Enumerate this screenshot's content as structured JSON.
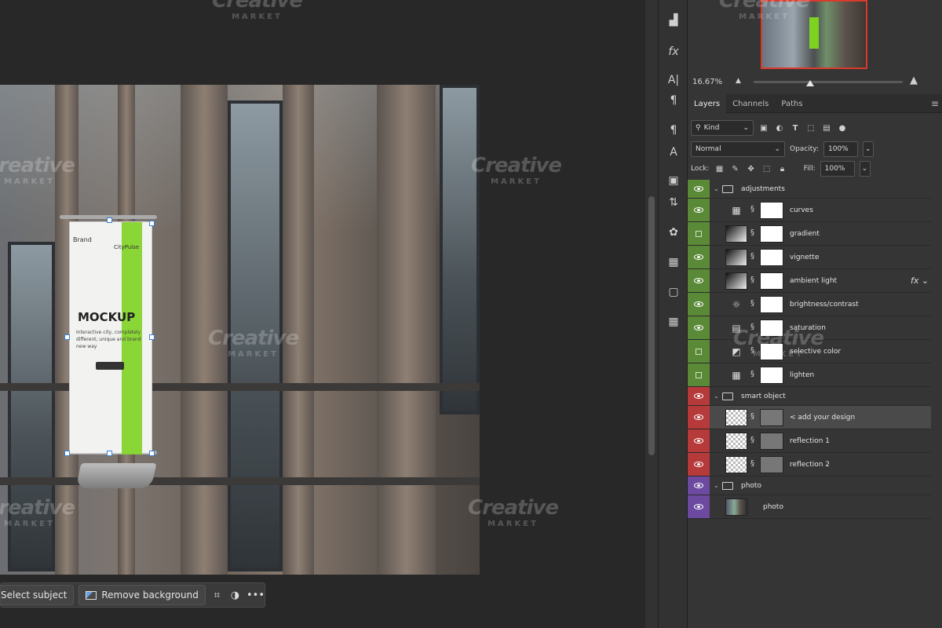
{
  "zoom": {
    "value": "16.67%"
  },
  "panel_tabs": [
    {
      "label": "Layers",
      "active": true
    },
    {
      "label": "Channels",
      "active": false
    },
    {
      "label": "Paths",
      "active": false
    }
  ],
  "filter": {
    "kind_label": "Kind"
  },
  "blend": {
    "mode": "Normal",
    "opacity_label": "Opacity:",
    "opacity_value": "100%"
  },
  "lock": {
    "label": "Lock:",
    "fill_label": "Fill:",
    "fill_value": "100%"
  },
  "layers": [
    {
      "name": "adjustments",
      "type": "group",
      "color": "#5a8a37"
    },
    {
      "name": "curves",
      "type": "adjustment",
      "icon": "curves-icon",
      "color": "#5a8a37",
      "visible": true
    },
    {
      "name": "gradient",
      "type": "adjustment",
      "icon": "gradient-icon",
      "color": "#5a8a37",
      "visible": false
    },
    {
      "name": "vignette",
      "type": "adjustment",
      "icon": "gradient-icon",
      "color": "#5a8a37",
      "visible": true
    },
    {
      "name": "ambient light",
      "type": "adjustment",
      "icon": "gradient-icon",
      "color": "#5a8a37",
      "visible": true,
      "fx": true
    },
    {
      "name": "brightness/contrast",
      "type": "adjustment",
      "icon": "brightness-icon",
      "color": "#5a8a37",
      "visible": true
    },
    {
      "name": "saturation",
      "type": "adjustment",
      "icon": "hue-saturation-icon",
      "color": "#5a8a37",
      "visible": true
    },
    {
      "name": "selective color",
      "type": "adjustment",
      "icon": "selective-color-icon",
      "color": "#5a8a37",
      "visible": false
    },
    {
      "name": "lighten",
      "type": "adjustment",
      "icon": "curves-icon",
      "color": "#5a8a37",
      "visible": false
    },
    {
      "name": "smart object",
      "type": "group",
      "color": "#b63a3a"
    },
    {
      "name": "< add your design",
      "type": "smart",
      "color": "#b63a3a",
      "visible": true,
      "selected": true
    },
    {
      "name": "reflection 1",
      "type": "smart",
      "color": "#b63a3a",
      "visible": true
    },
    {
      "name": "reflection 2",
      "type": "smart",
      "color": "#b63a3a",
      "visible": true
    },
    {
      "name": "photo",
      "type": "group",
      "color": "#6c4aa0"
    },
    {
      "name": "photo",
      "type": "photo",
      "color": "#6c4aa0",
      "visible": true
    }
  ],
  "banner": {
    "brand": "Brand",
    "city": "CityPulse",
    "title": "MOCKUP",
    "text": "Interactive city, completely different, unique and brand new way"
  },
  "taskbar": {
    "select_subject": "Select subject",
    "remove_background": "Remove background"
  },
  "watermark": {
    "big": "Creative",
    "small": "MARKET"
  }
}
